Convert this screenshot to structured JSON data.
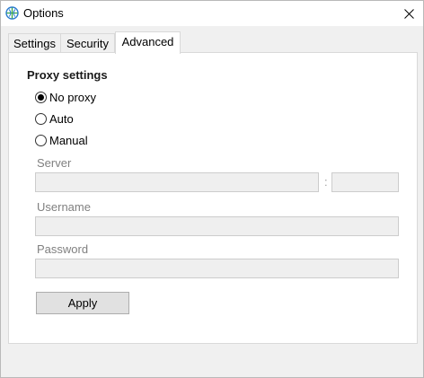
{
  "window": {
    "title": "Options"
  },
  "tabs": [
    {
      "label": "Settings"
    },
    {
      "label": "Security"
    },
    {
      "label": "Advanced"
    }
  ],
  "proxy": {
    "heading": "Proxy settings",
    "options": [
      {
        "label": "No proxy",
        "checked": true
      },
      {
        "label": "Auto",
        "checked": false
      },
      {
        "label": "Manual",
        "checked": false
      }
    ]
  },
  "fields": {
    "server_label": "Server",
    "server_value": "",
    "port_separator": ":",
    "port_value": "",
    "username_label": "Username",
    "username_value": "",
    "password_label": "Password",
    "password_value": ""
  },
  "buttons": {
    "apply_label": "Apply"
  },
  "icons": {
    "app": "globe-icon",
    "close": "close-icon"
  },
  "colors": {
    "disabled_text": "#808080",
    "disabled_field": "#efefef"
  }
}
